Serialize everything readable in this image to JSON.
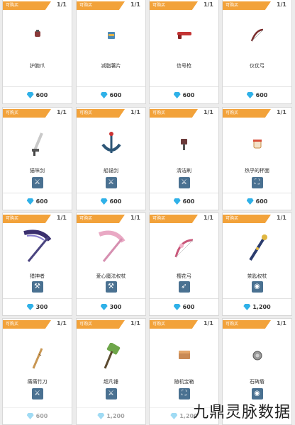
{
  "tag_label": "可购买",
  "rows": [
    {
      "cards": [
        {
          "count": "1/1",
          "name": "护腕爪",
          "icon": "gauntlet-icon",
          "type": "none",
          "price": "600"
        },
        {
          "count": "1/1",
          "name": "减脂薯片",
          "icon": "chips-icon",
          "type": "none",
          "price": "600"
        },
        {
          "count": "1/1",
          "name": "信号枪",
          "icon": "flare-gun-icon",
          "type": "none",
          "price": "600"
        },
        {
          "count": "1/1",
          "name": "仪仗弓",
          "icon": "bow-icon",
          "type": "none",
          "price": "600"
        }
      ]
    },
    {
      "cards": [
        {
          "count": "1/1",
          "name": "猫咪剑",
          "icon": "sword-icon",
          "type": "sword-icon",
          "price": "600"
        },
        {
          "count": "1/1",
          "name": "船锚剑",
          "icon": "anchor-icon",
          "type": "sword-icon",
          "price": "600"
        },
        {
          "count": "1/1",
          "name": "清洁刷",
          "icon": "brush-icon",
          "type": "sword-icon",
          "price": "600"
        },
        {
          "count": "1/1",
          "name": "热乎的杯面",
          "icon": "cup-noodle-icon",
          "type": "basket-icon",
          "price": "600"
        }
      ]
    },
    {
      "cards": [
        {
          "count": "1/1",
          "name": "猎神者",
          "icon": "scythe-icon",
          "type": "staff-icon",
          "price": "300"
        },
        {
          "count": "1/1",
          "name": "爱心魔法权杖",
          "icon": "heart-scythe-icon",
          "type": "staff-icon",
          "price": "300"
        },
        {
          "count": "1/1",
          "name": "樱花弓",
          "icon": "sakura-bow-icon",
          "type": "bow-icon",
          "price": "600"
        },
        {
          "count": "1/1",
          "name": "茶匙权杖",
          "icon": "scepter-icon",
          "type": "globe-icon",
          "price": "1,200"
        }
      ]
    },
    {
      "cards": [
        {
          "count": "1/1",
          "name": "痛痛竹刀",
          "icon": "bamboo-sword-icon",
          "type": "sword-icon",
          "price": "600"
        },
        {
          "count": "1/1",
          "name": "超凡锤",
          "icon": "hammer-icon",
          "type": "sword-icon",
          "price": "1,200"
        },
        {
          "count": "1/1",
          "name": "随机宝箱",
          "icon": "chest-icon",
          "type": "basket-icon",
          "price": "1,200"
        },
        {
          "count": "1/1",
          "name": "石碑盾",
          "icon": "shield-icon",
          "type": "globe-icon",
          "price": ""
        }
      ]
    }
  ],
  "watermark": "九鼎灵脉数据",
  "colors": {
    "tag": "#f2a23a",
    "type_icon": "#4a7191",
    "gem": "#2fb1e8"
  }
}
